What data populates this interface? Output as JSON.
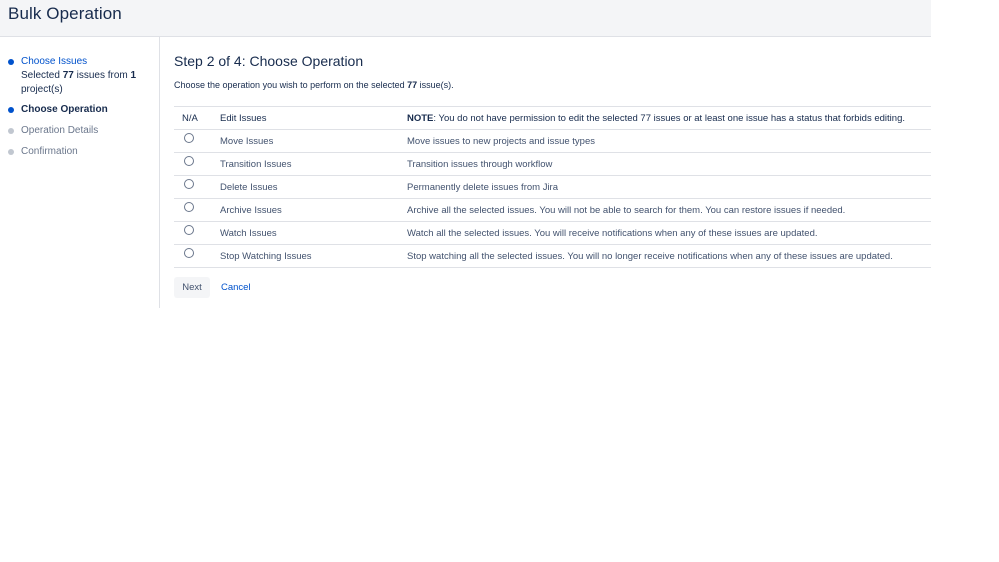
{
  "header": {
    "title": "Bulk Operation"
  },
  "sidebar": {
    "steps": [
      {
        "label": "Choose Issues",
        "state": "done",
        "summary_prefix": "Selected ",
        "summary_issue_count": "77",
        "summary_middle": " issues from ",
        "summary_project_count": "1",
        "summary_suffix": " project(s)"
      },
      {
        "label": "Choose Operation",
        "state": "current"
      },
      {
        "label": "Operation Details",
        "state": "todo"
      },
      {
        "label": "Confirmation",
        "state": "todo"
      }
    ]
  },
  "main": {
    "title": "Step 2 of 4: Choose Operation",
    "description_prefix": "Choose the operation you wish to perform on the selected ",
    "description_count": "77",
    "description_suffix": " issue(s).",
    "operations": [
      {
        "selector": "N/A",
        "name": "Edit Issues",
        "note_label": "NOTE",
        "description": ": You do not have permission to edit the selected 77 issues or at least one issue has a status that forbids editing."
      },
      {
        "name": "Move Issues",
        "description": "Move issues to new projects and issue types"
      },
      {
        "name": "Transition Issues",
        "description": "Transition issues through workflow"
      },
      {
        "name": "Delete Issues",
        "description": "Permanently delete issues from Jira"
      },
      {
        "name": "Archive Issues",
        "description": "Archive all the selected issues. You will not be able to search for them. You can restore issues if needed."
      },
      {
        "name": "Watch Issues",
        "description": "Watch all the selected issues. You will receive notifications when any of these issues are updated."
      },
      {
        "name": "Stop Watching Issues",
        "description": "Stop watching all the selected issues. You will no longer receive notifications when any of these issues are updated."
      }
    ],
    "next_label": "Next",
    "cancel_label": "Cancel"
  },
  "colors": {
    "link": "#0052cc",
    "text": "#172b4d",
    "muted": "#6b778c",
    "header_bg": "#f4f5f7",
    "border": "#dfe1e6"
  }
}
